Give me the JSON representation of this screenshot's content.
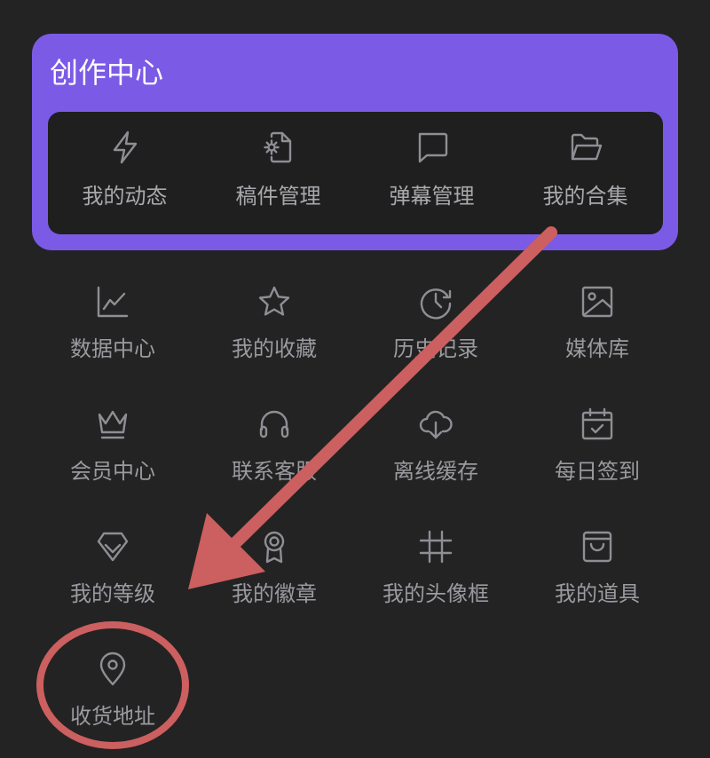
{
  "creator_center": {
    "title": "创作中心",
    "items": [
      {
        "label": "我的动态",
        "icon": "lightning-icon"
      },
      {
        "label": "稿件管理",
        "icon": "file-gear-icon"
      },
      {
        "label": "弹幕管理",
        "icon": "chat-bubble-icon"
      },
      {
        "label": "我的合集",
        "icon": "folder-open-icon"
      }
    ]
  },
  "grid": {
    "items": [
      {
        "label": "数据中心",
        "icon": "line-chart-icon"
      },
      {
        "label": "我的收藏",
        "icon": "star-icon"
      },
      {
        "label": "历史记录",
        "icon": "history-clock-icon"
      },
      {
        "label": "媒体库",
        "icon": "image-icon"
      },
      {
        "label": "会员中心",
        "icon": "crown-icon"
      },
      {
        "label": "联系客服",
        "icon": "headset-icon"
      },
      {
        "label": "离线缓存",
        "icon": "cloud-download-icon"
      },
      {
        "label": "每日签到",
        "icon": "calendar-check-icon"
      },
      {
        "label": "我的等级",
        "icon": "diamond-level-icon"
      },
      {
        "label": "我的徽章",
        "icon": "badge-ribbon-icon"
      },
      {
        "label": "我的头像框",
        "icon": "frame-hash-icon"
      },
      {
        "label": "我的道具",
        "icon": "shopping-bag-icon"
      },
      {
        "label": "收货地址",
        "icon": "map-pin-icon"
      }
    ]
  },
  "annotation": {
    "color": "#cc5f5f"
  }
}
